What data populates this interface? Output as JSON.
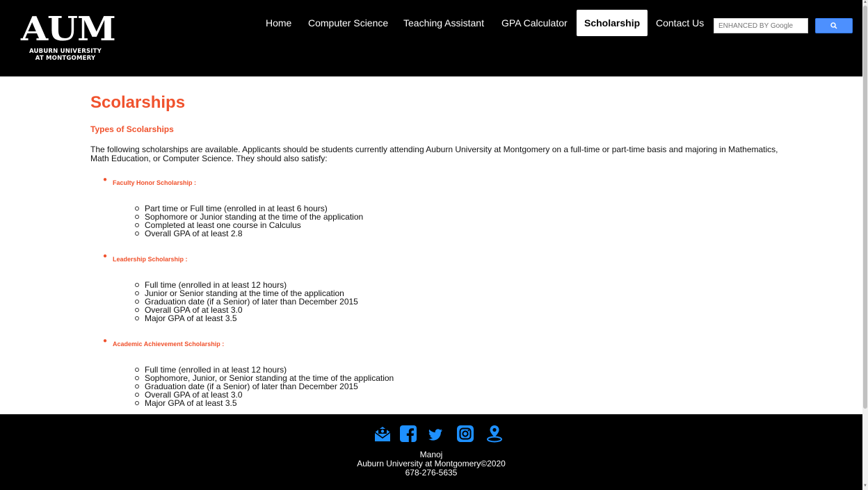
{
  "header": {
    "logo": {
      "mark": "AUM",
      "line1": "AUBURN UNIVERSITY",
      "line2": "AT MONTGOMERY"
    },
    "nav": [
      {
        "label": "Home"
      },
      {
        "label": "Computer Science"
      },
      {
        "label": "Teaching Assistant"
      },
      {
        "label": "GPA Calculator"
      },
      {
        "label": "Scholarship",
        "active": true
      },
      {
        "label": "Contact Us"
      }
    ],
    "search": {
      "placeholder": "ENHANCED BY Google",
      "button_icon": "search-icon"
    }
  },
  "main": {
    "title": "Scolarships",
    "section_title": "Types of Scolarships",
    "intro": "The following scholarships are available. Applicants should be students currently attending Auburn University at Montgomery on a full-time or part-time basis and majoring in Mathematics, Math Education, or Computer Science. They should also satisfy:",
    "scholarships": [
      {
        "name": "Faculty Honor Scholarship :",
        "criteria": [
          "Part time or Full time (enrolled in at least 6 hours)",
          "Sophomore or Junior standing at the time of the application",
          "Completed at least one course in Calculus",
          "Overall GPA of at least 2.8"
        ]
      },
      {
        "name": "Leadership Scholarship :",
        "criteria": [
          "Full time (enrolled in at least 12 hours)",
          "Junior or Senior standing at the time of the application",
          "Graduation date (if a Senior) of later than December 2015",
          "Overall GPA of at least 3.0",
          "Major GPA of at least 3.5"
        ]
      },
      {
        "name": "Academic Achievement Scholarship :",
        "criteria": [
          "Full time (enrolled in at least 12 hours)",
          "Sophomore, Junior, or Senior standing at the time of the application",
          "Graduation date (if a Senior) of later than December 2015",
          "Overall GPA of at least 3.0",
          "Major GPA of at least 3.5"
        ]
      }
    ]
  },
  "footer": {
    "social_icons": [
      "email-icon",
      "facebook-icon",
      "twitter-icon",
      "instagram-icon",
      "location-icon"
    ],
    "name": "Manoj",
    "copyright": "Auburn University at Montgomery©2020",
    "phone": "678-276-5635"
  },
  "colors": {
    "accent": "#f0522d",
    "header_bg": "#000000",
    "icon_blue": "#1e90ff",
    "search_button": "#4d90fe"
  }
}
